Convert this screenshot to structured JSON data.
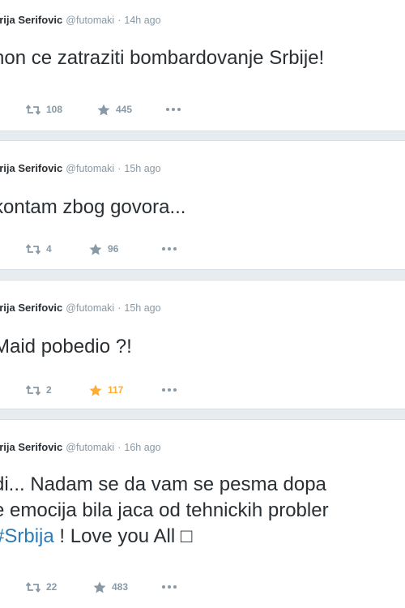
{
  "colors": {
    "background": "#e6ecf0",
    "card": "#ffffff",
    "text": "#292f33",
    "muted": "#8899a6",
    "link": "#2b7bb9",
    "favorited": "#ffac33"
  },
  "tweets": [
    {
      "name": "arija Serifovic",
      "handle": "@futomaki",
      "time": "14h ago",
      "text": "hon ce zatraziti bombardovanje Srbije!",
      "retweets": "108",
      "favorites": "445"
    },
    {
      "name": "arija Serifovic",
      "handle": "@futomaki",
      "time": "15h ago",
      "text": "kontam zbog govora...",
      "retweets": "4",
      "favorites": "96"
    },
    {
      "name": "arija Serifovic",
      "handle": "@futomaki",
      "time": "15h ago",
      "text": "Maid pobedio ?!",
      "retweets": "2",
      "favorites": "117",
      "favorited": true
    },
    {
      "name": "arija Serifovic",
      "handle": "@futomaki",
      "time": "16h ago",
      "text_line_1": "di... Nadam se da vam se pesma dopa",
      "text_line_2": "e emocija bila jaca od tehnickih probler",
      "hashtag": "#Srbija",
      "text_line_3_rest": " ! Love you All ",
      "trailing_glyph": "□",
      "retweets": "22",
      "favorites": "483"
    }
  ],
  "icons": {
    "retweet": "retweet-icon",
    "favorite": "star-icon",
    "more": "more-dots-icon"
  }
}
